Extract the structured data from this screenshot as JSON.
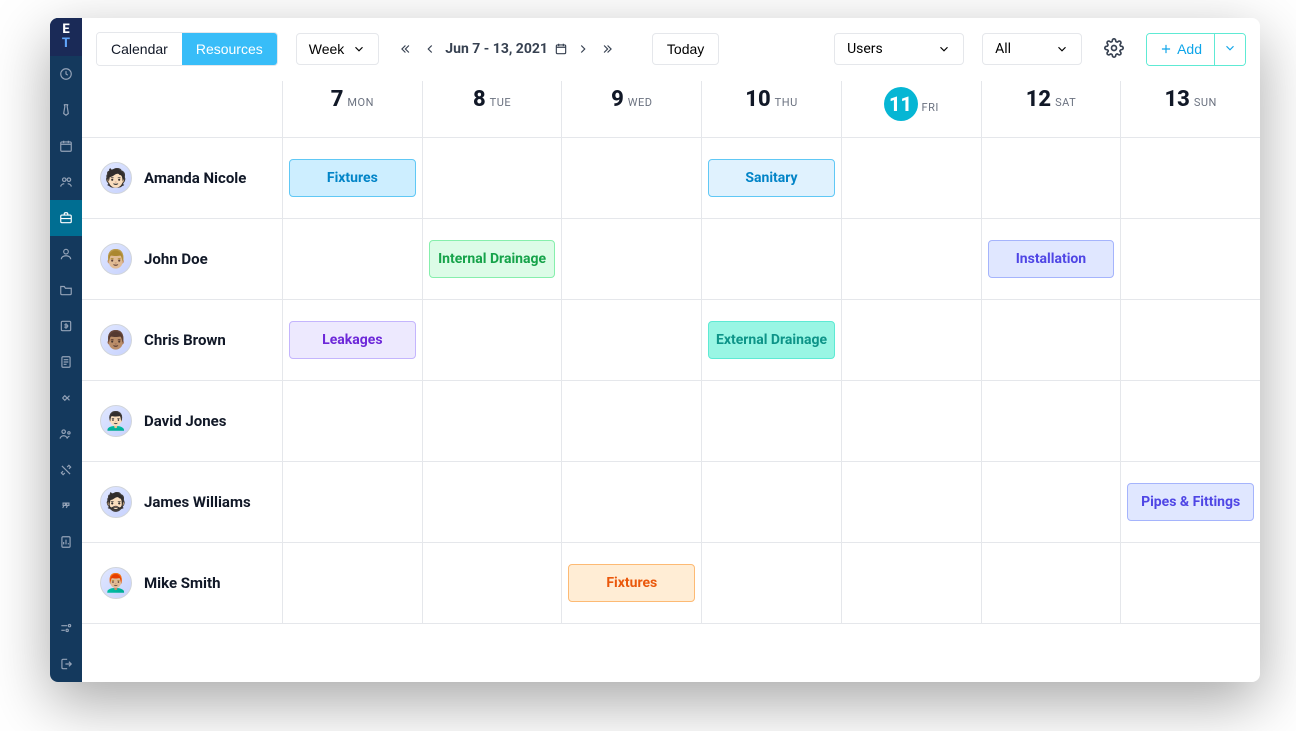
{
  "brand": {
    "line1": "E",
    "line2": "T"
  },
  "toolbar": {
    "calendar_label": "Calendar",
    "resources_label": "Resources",
    "period_label": "Week",
    "range": "Jun 7 - 13, 2021",
    "today_label": "Today",
    "select_users_label": "Users",
    "select_all_label": "All",
    "add_label": "Add"
  },
  "days": [
    {
      "num": "7",
      "dow": "MON",
      "today": false
    },
    {
      "num": "8",
      "dow": "TUE",
      "today": false
    },
    {
      "num": "9",
      "dow": "WED",
      "today": false
    },
    {
      "num": "10",
      "dow": "THU",
      "today": false
    },
    {
      "num": "11",
      "dow": "FRI",
      "today": true
    },
    {
      "num": "12",
      "dow": "SAT",
      "today": false
    },
    {
      "num": "13",
      "dow": "SUN",
      "today": false
    }
  ],
  "users": [
    {
      "name": "Amanda Nicole",
      "avatar_bg": "#fde68a"
    },
    {
      "name": "John Doe",
      "avatar_bg": "#bae6fd"
    },
    {
      "name": "Chris Brown",
      "avatar_bg": "#ddd6fe"
    },
    {
      "name": "David Jones",
      "avatar_bg": "#e5e7eb"
    },
    {
      "name": "James Williams",
      "avatar_bg": "#fecdd3"
    },
    {
      "name": "Mike Smith",
      "avatar_bg": "#fed7aa"
    }
  ],
  "tasks": {
    "amanda_mon": "Fixtures",
    "amanda_thu": "Sanitary",
    "john_tue": "Internal Drainage",
    "john_sat": "Installation",
    "chris_mon": "Leakages",
    "chris_thu": "External Drainage",
    "james_sun": "Pipes & Fittings",
    "mike_wed": "Fixtures"
  }
}
